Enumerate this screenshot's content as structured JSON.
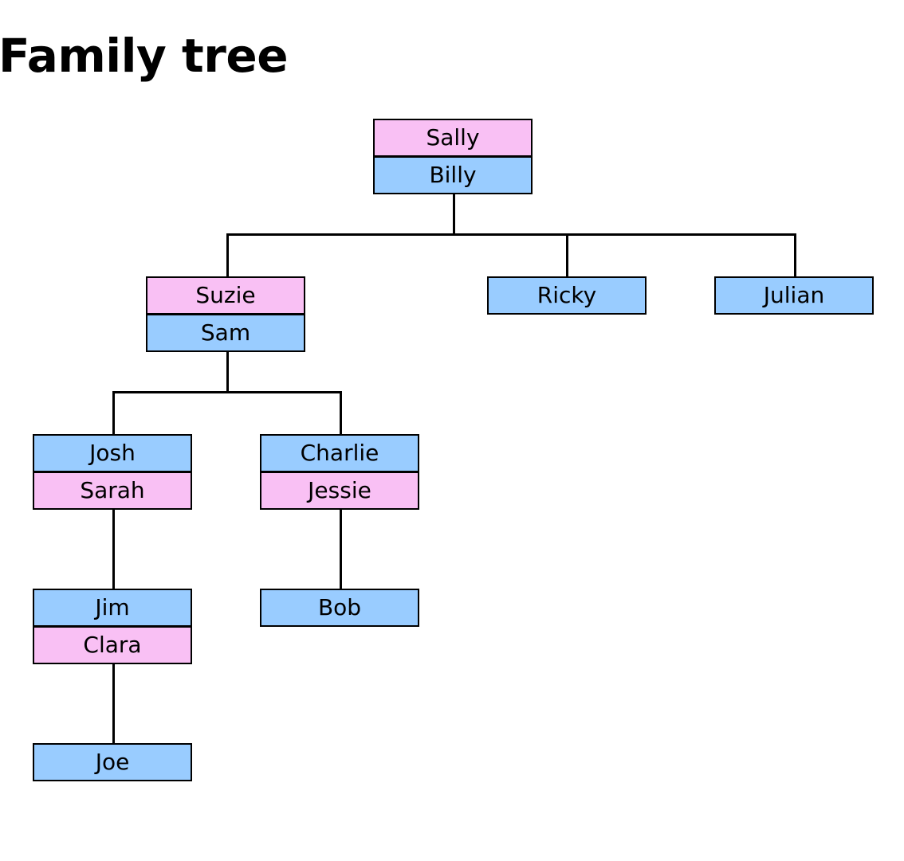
{
  "page": {
    "title": "Family tree"
  },
  "colors": {
    "male": "#99ccff",
    "female": "#f9c0f4",
    "border": "#000000"
  },
  "tree": {
    "root": {
      "members": [
        {
          "name": "Sally",
          "sex": "female"
        },
        {
          "name": "Billy",
          "sex": "male"
        }
      ]
    },
    "suzie_sam": {
      "members": [
        {
          "name": "Suzie",
          "sex": "female"
        },
        {
          "name": "Sam",
          "sex": "male"
        }
      ]
    },
    "ricky": {
      "members": [
        {
          "name": "Ricky",
          "sex": "male"
        }
      ]
    },
    "julian": {
      "members": [
        {
          "name": "Julian",
          "sex": "male"
        }
      ]
    },
    "josh_sarah": {
      "members": [
        {
          "name": "Josh",
          "sex": "male"
        },
        {
          "name": "Sarah",
          "sex": "female"
        }
      ]
    },
    "charlie_jessie": {
      "members": [
        {
          "name": "Charlie",
          "sex": "male"
        },
        {
          "name": "Jessie",
          "sex": "female"
        }
      ]
    },
    "jim_clara": {
      "members": [
        {
          "name": "Jim",
          "sex": "male"
        },
        {
          "name": "Clara",
          "sex": "female"
        }
      ]
    },
    "bob": {
      "members": [
        {
          "name": "Bob",
          "sex": "male"
        }
      ]
    },
    "joe": {
      "members": [
        {
          "name": "Joe",
          "sex": "male"
        }
      ]
    }
  }
}
